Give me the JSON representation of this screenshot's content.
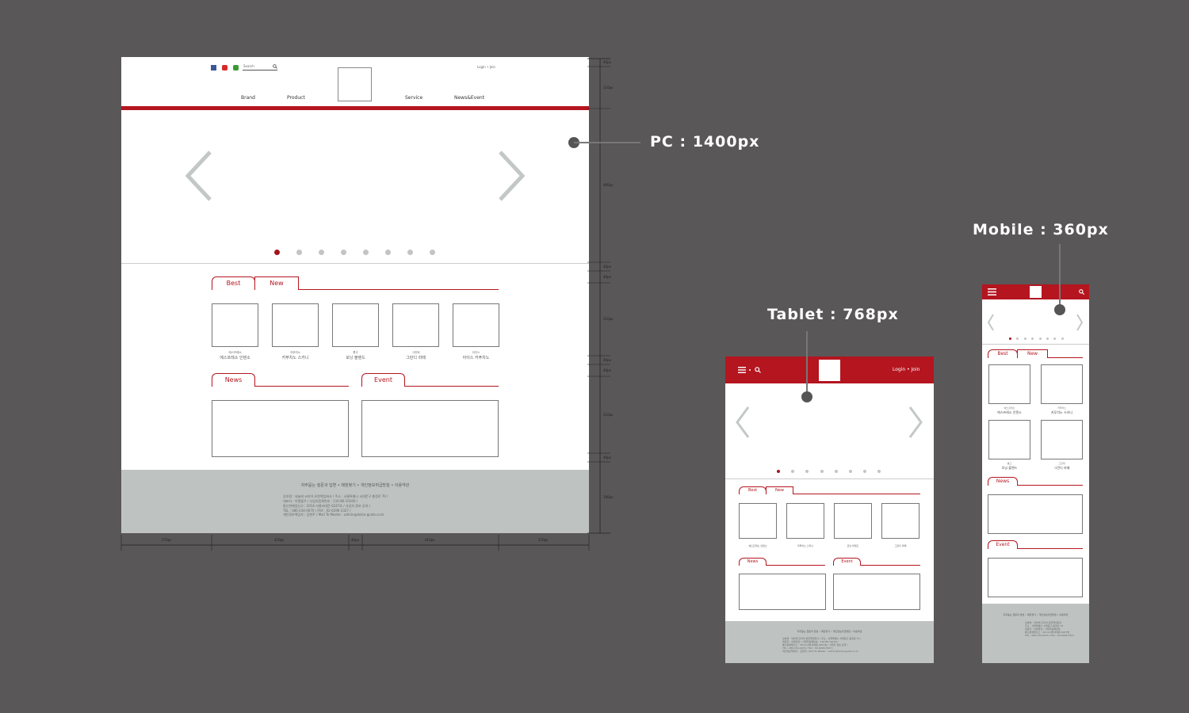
{
  "labels": {
    "pc": "PC : 1400px",
    "tablet": "Tablet : 768px",
    "mobile": "Mobile : 360px"
  },
  "pc": {
    "search_placeholder": "Search",
    "auth": "Login  •  Join",
    "nav": [
      "Brand",
      "Product",
      "Service",
      "News&Event"
    ],
    "tabs": {
      "best": "Best",
      "new": "New",
      "news": "News",
      "event": "Event"
    },
    "products": [
      {
        "sub": "에스프레소",
        "name": "에스프레소 인텐소"
      },
      {
        "sub": "카푸치노",
        "name": "카푸치노 스카니"
      },
      {
        "sub": "룽고",
        "name": "모닝 블렌드"
      },
      {
        "sub": "그란데",
        "name": "그란디 라떼"
      },
      {
        "sub": "아이스",
        "name": "아이스 카푸치노"
      }
    ],
    "footer_links": "자주묻는 질문과 답변 • 매장찾기 • 개인정보취급방침 • 이용약관",
    "footer_info": [
      "상호명 : 네슬레 코리아 유한책임회사 / 주소 : 서울특별시 서대문구 충정로 70 /",
      "대표자 : 어렌볼르 / 사업자등록번호 : 110-86-10100 /",
      "통신판매업신고 : 2014-서울서대문-0247호 / 사업자 정보 공개 /",
      "TEL : 080-234-0070 / FAX : 02-6296-3327 /",
      "개인정보책임자 : 김현주 / Mail To Master : admin@dolce-gusto.co.kr"
    ],
    "dims_vertical": [
      "40px",
      "110px",
      "460px",
      "40px",
      "40px",
      "210px",
      "40px",
      "40px",
      "210px",
      "40px",
      "190px"
    ],
    "dims_horizontal": [
      "270px",
      "410px",
      "40px",
      "410px",
      "270px"
    ]
  },
  "tablet": {
    "auth": "Login  •  Join",
    "tabs": {
      "best": "Best",
      "new": "New",
      "news": "News",
      "event": "Event"
    },
    "products": [
      "에스프레소 인텐소",
      "카푸치노 스카니",
      "모닝 블렌드",
      "그란디 라떼"
    ],
    "footer_links": "자주묻는 질문과 답변 • 매장찾기 • 개인정보취급방침 • 이용약관",
    "footer_info": [
      "상호명 : 네슬레 코리아 유한책임회사 / 주소 : 서울특별시 서대문구 충정로 70 /",
      "대표자 : 어렌볼르 / 사업자등록번호 : 110-86-10100 /",
      "통신판매업신고 : 2014-서울서대문-0247호 / 사업자 정보 공개 /",
      "TEL : 080-234-0070 / FAX : 02-6296-3327 /",
      "개인정보책임자 : 김현주 / Mail To Master : admin@dolce-gusto.co.kr"
    ]
  },
  "mobile": {
    "tabs": {
      "best": "Best",
      "new": "New",
      "news": "News",
      "event": "Event"
    },
    "products": [
      {
        "sub": "에스프레소",
        "name": "에스프레소 인텐소"
      },
      {
        "sub": "카푸치노",
        "name": "카푸치노 스카니"
      },
      {
        "sub": "룽고",
        "name": "모닝 블렌드"
      },
      {
        "sub": "그란데",
        "name": "그란디 라떼"
      }
    ],
    "footer_links": "자주묻는 질문과 답변 • 매장찾기 • 개인정보취급방침 • 이용약관",
    "footer_info": [
      "상호명 : 네슬레 코리아 유한책임회사",
      "주소 : 서울특별시 서대문구 충정로 70",
      "대표자 : 어렌볼르 / 사업자등록번호",
      "통신판매업신고 : 2014-서울서대문-0247호",
      "TEL : 080-234-0070 / FAX : 02-6296-3327"
    ]
  },
  "colors": {
    "accent": "#b4151f",
    "background": "#5a5758",
    "footer": "#bec3c1"
  },
  "icons": [
    "facebook-icon",
    "youtube-icon",
    "kakao-icon",
    "search-icon",
    "menu-icon",
    "chevron-left-icon",
    "chevron-right-icon"
  ]
}
